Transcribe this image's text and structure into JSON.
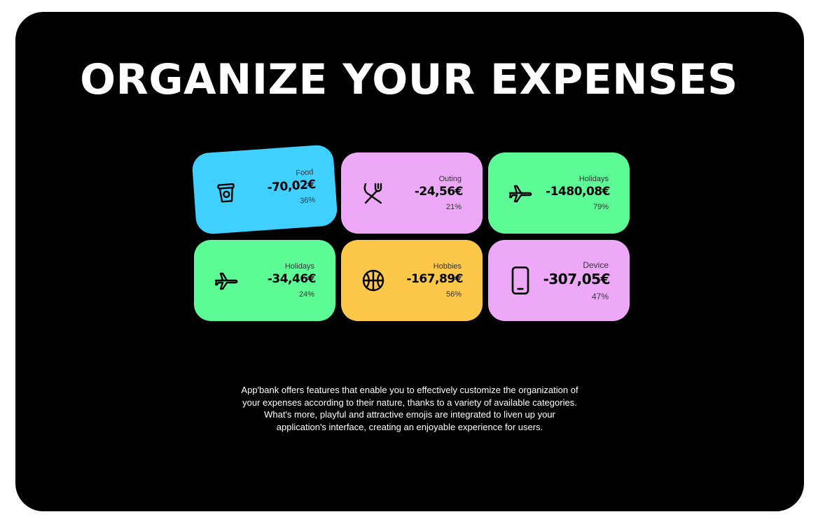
{
  "page": {
    "title": "ORGANIZE YOUR EXPENSES",
    "description": "App'bank offers features that enable you to effectively customize the organization of your expenses according to their nature, thanks to a variety of available categories. What's more, playful and attractive emojis are integrated to liven up your application's interface, creating an enjoyable experience for users."
  },
  "colors": {
    "background": "#000000",
    "blue": "#3fd0ff",
    "pink": "#eda8f8",
    "green": "#5cfb95",
    "orange": "#fdc74a"
  },
  "cards": [
    {
      "label": "Food",
      "amount": "-70,02€",
      "percent": "36%",
      "icon": "coffee-cup-icon",
      "color": "#3fd0ff"
    },
    {
      "label": "Outing",
      "amount": "-24,56€",
      "percent": "21%",
      "icon": "fork-knife-icon",
      "color": "#eda8f8"
    },
    {
      "label": "Holidays",
      "amount": "-1480,08€",
      "percent": "79%",
      "icon": "airplane-icon",
      "color": "#5cfb95"
    },
    {
      "label": "Holidays",
      "amount": "-34,46€",
      "percent": "24%",
      "icon": "airplane-icon",
      "color": "#5cfb95"
    },
    {
      "label": "Hobbies",
      "amount": "-167,89€",
      "percent": "56%",
      "icon": "basketball-icon",
      "color": "#fdc74a"
    },
    {
      "label": "Device",
      "amount": "-307,05€",
      "percent": "47%",
      "icon": "smartphone-icon",
      "color": "#eda8f8"
    }
  ]
}
